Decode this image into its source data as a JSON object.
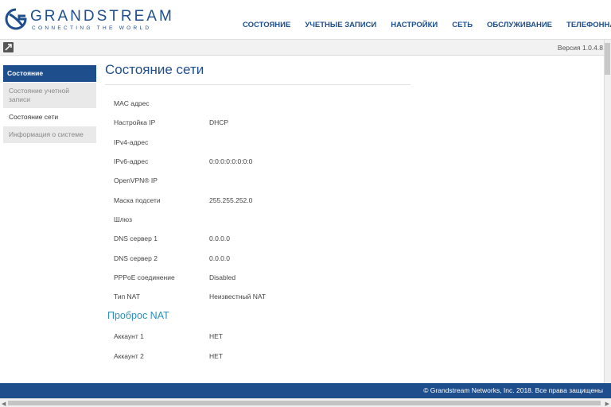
{
  "header": {
    "logo_name": "GRANDSTREAM",
    "logo_tagline": "CONNECTING THE WORLD",
    "nav": [
      {
        "label": "СОСТОЯНИЕ"
      },
      {
        "label": "УЧЕТНЫЕ ЗАПИСИ"
      },
      {
        "label": "НАСТРОЙКИ"
      },
      {
        "label": "СЕТЬ"
      },
      {
        "label": "ОБСЛУЖИВАНИЕ"
      },
      {
        "label": "ТЕЛЕФОННАЯ КНИ"
      }
    ]
  },
  "subbar": {
    "version": "Версия 1.0.4.8"
  },
  "sidebar": {
    "header": "Состояние",
    "items": [
      {
        "label": "Состояние учетной записи"
      },
      {
        "label": "Состояние сети"
      },
      {
        "label": "Информация о системе"
      }
    ]
  },
  "main": {
    "title": "Состояние сети",
    "rows": [
      {
        "label": "MAC адрес",
        "value": ""
      },
      {
        "label": "Настройка IP",
        "value": "DHCP"
      },
      {
        "label": "IPv4-адрес",
        "value": ""
      },
      {
        "label": "IPv6-адрес",
        "value": "0:0:0:0:0:0:0:0"
      },
      {
        "label": "OpenVPN® IP",
        "value": ""
      },
      {
        "label": "Маска подсети",
        "value": "255.255.252.0"
      },
      {
        "label": "Шлюз",
        "value": ""
      },
      {
        "label": "DNS сервер 1",
        "value": "0.0.0.0"
      },
      {
        "label": "DNS сервер 2",
        "value": "0.0.0.0"
      },
      {
        "label": "PPPoE соединение",
        "value": "Disabled"
      },
      {
        "label": "Тип NAT",
        "value": "Неизвестный NAT"
      }
    ],
    "nat_title": "Проброс NAT",
    "nat_rows": [
      {
        "label": "Аккаунт 1",
        "value": "НЕТ"
      },
      {
        "label": "Аккаунт 2",
        "value": "НЕТ"
      }
    ]
  },
  "footer": {
    "text": "© Grandstream Networks, Inc. 2018. Все права защищены"
  },
  "colors": {
    "brand": "#1f4e8c",
    "section": "#2a8fbf"
  }
}
